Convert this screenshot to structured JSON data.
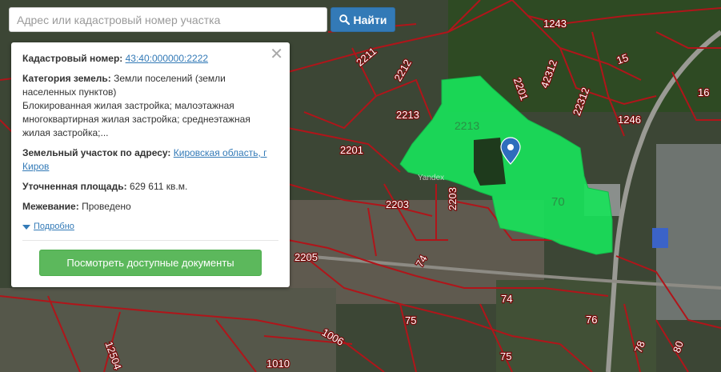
{
  "search": {
    "placeholder": "Адрес или кадастровый номер участка",
    "button_label": "Найти",
    "button_icon": "search-icon"
  },
  "info_panel": {
    "cadastral_label": "Кадастровый номер:",
    "cadastral_value": "43:40:000000:2222",
    "category_label": "Категория земель:",
    "category_value": "Земли поселений (земли населенных пунктов)",
    "use_value": "Блокированная жилая застройка; малоэтажная многоквартирная жилая застройка; среднеэтажная жилая застройка;...",
    "address_label": "Земельный участок по адресу:",
    "address_value": "Кировская область, г Киров",
    "area_label": "Уточненная площадь:",
    "area_value": "629 611 кв.м.",
    "survey_label": "Межевание:",
    "survey_value": "Проведено",
    "more_label": "Подробно",
    "docs_button_label": "Посмотреть доступные документы",
    "close_icon": "close-icon"
  },
  "map": {
    "watermark": "Yandex",
    "parcel_color": "#19e25a",
    "boundary_color": "#b0151a",
    "labels": [
      {
        "id": "2211",
        "text": "2211"
      },
      {
        "id": "2212",
        "text": "2212"
      },
      {
        "id": "2213a",
        "text": "2213"
      },
      {
        "id": "2213b",
        "text": "2213"
      },
      {
        "id": "2201a",
        "text": "2201"
      },
      {
        "id": "2201b",
        "text": "2201"
      },
      {
        "id": "2203a",
        "text": "2203"
      },
      {
        "id": "2203b",
        "text": "2203"
      },
      {
        "id": "2205",
        "text": "2205"
      },
      {
        "id": "70",
        "text": "70"
      },
      {
        "id": "74a",
        "text": "74"
      },
      {
        "id": "74b",
        "text": "74"
      },
      {
        "id": "75a",
        "text": "75"
      },
      {
        "id": "75b",
        "text": "75"
      },
      {
        "id": "76",
        "text": "76"
      },
      {
        "id": "78",
        "text": "78"
      },
      {
        "id": "80",
        "text": "80"
      },
      {
        "id": "1006",
        "text": "1006"
      },
      {
        "id": "1010",
        "text": "1010"
      },
      {
        "id": "12504",
        "text": "12504"
      },
      {
        "id": "1243",
        "text": "1243"
      },
      {
        "id": "1246",
        "text": "1246"
      },
      {
        "id": "15",
        "text": "15"
      },
      {
        "id": "16",
        "text": "16"
      },
      {
        "id": "42312",
        "text": "42312"
      },
      {
        "id": "22312",
        "text": "22312"
      }
    ]
  }
}
